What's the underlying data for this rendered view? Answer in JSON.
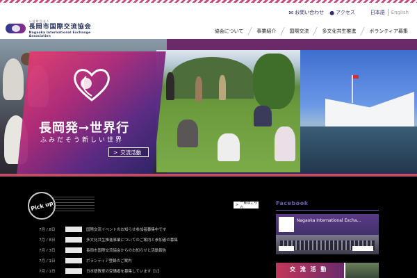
{
  "header": {
    "logo_small": "公益財団法人",
    "logo_ja": "長岡市国際交流協会",
    "logo_en": "Nagaoka International Exchange Association",
    "toplinks": [
      {
        "label": "お問い合わせ",
        "icon": "mail-icon"
      },
      {
        "label": "アクセス",
        "icon": "map-pin-icon"
      }
    ],
    "lang": {
      "ja": "日本語",
      "en": "English"
    },
    "nav": [
      "協会について",
      "事業紹介",
      "国際交流",
      "多文化共生推進",
      "ボランティア募集"
    ]
  },
  "hero": {
    "title": "長岡発→世界行",
    "subtitle": "ふみだそう新しい世界",
    "button": "交流活動"
  },
  "pickup": {
    "badge": "Pick up",
    "list_button": "一覧はこちら",
    "news": [
      {
        "date": "7月 / 8日",
        "title": "国際交流イベントのお知らせ参加者募集中です"
      },
      {
        "date": "7月 / 8日",
        "title": "多文化共生推進事業についてのご案内と参加者の募集"
      },
      {
        "date": "7月 / 3日",
        "title": "長岡市国際交流協会からのお知らせと活動報告"
      },
      {
        "date": "7月 / 1日",
        "title": "ボランティア登録のご案内"
      },
      {
        "date": "7月 / 1日",
        "title": "日本語教室の受講者を募集しています【1】"
      }
    ]
  },
  "facebook": {
    "heading": "Facebook",
    "page_name": "Nagaoka International Excha..."
  },
  "banner": {
    "label": "交 流 活 動"
  }
}
